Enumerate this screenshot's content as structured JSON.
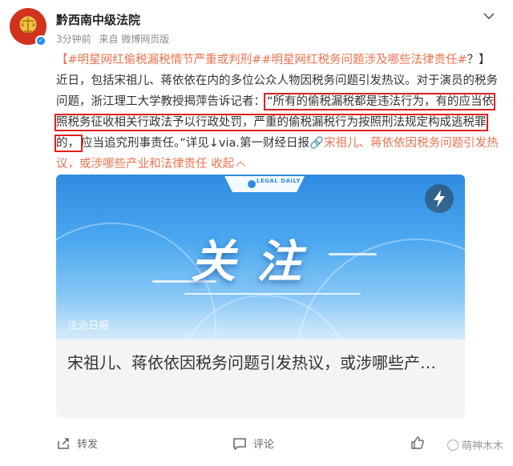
{
  "post": {
    "author": "黔西南中级法院",
    "time": "3分钟前",
    "source": "来自 微博网页版",
    "text": {
      "tag_open": "【",
      "tag1": "#明星网红偷税漏税情节严重或判刑#",
      "tag2": "#明星网红税务问题涉及哪些法律责任#",
      "after_tags": "？】近日，包括宋祖儿、蒋依依在内的多位公众人物因税务问题引发热议。对于演员的税务问题，浙江理工大学教授揭萍告诉记者：",
      "quote": "“所有的偷税漏税都是违法行为，有的应当依照税务征收相关行政法予以行政处罚，严重的偷税漏税行为按照刑法规定构成逃税罪的，",
      "after_quote": "应当追究刑事责任。”详见↓via.第一财经日报",
      "link": "宋祖儿、蒋依依因税务问题引发热议，或涉哪些产业和法律责任",
      "collapse": "收起"
    }
  },
  "card": {
    "logo_text": "LEGAL DAILY",
    "big_title": "关注",
    "watermark": "法治日报",
    "caption": "宋祖儿、蒋依依因税务问题引发热议，或涉哪些产…"
  },
  "footer": {
    "repost": "转发",
    "comment": "评论",
    "site": "萌神木木"
  },
  "colors": {
    "accent": "#eb7350",
    "highlight_box": "#e02020"
  }
}
